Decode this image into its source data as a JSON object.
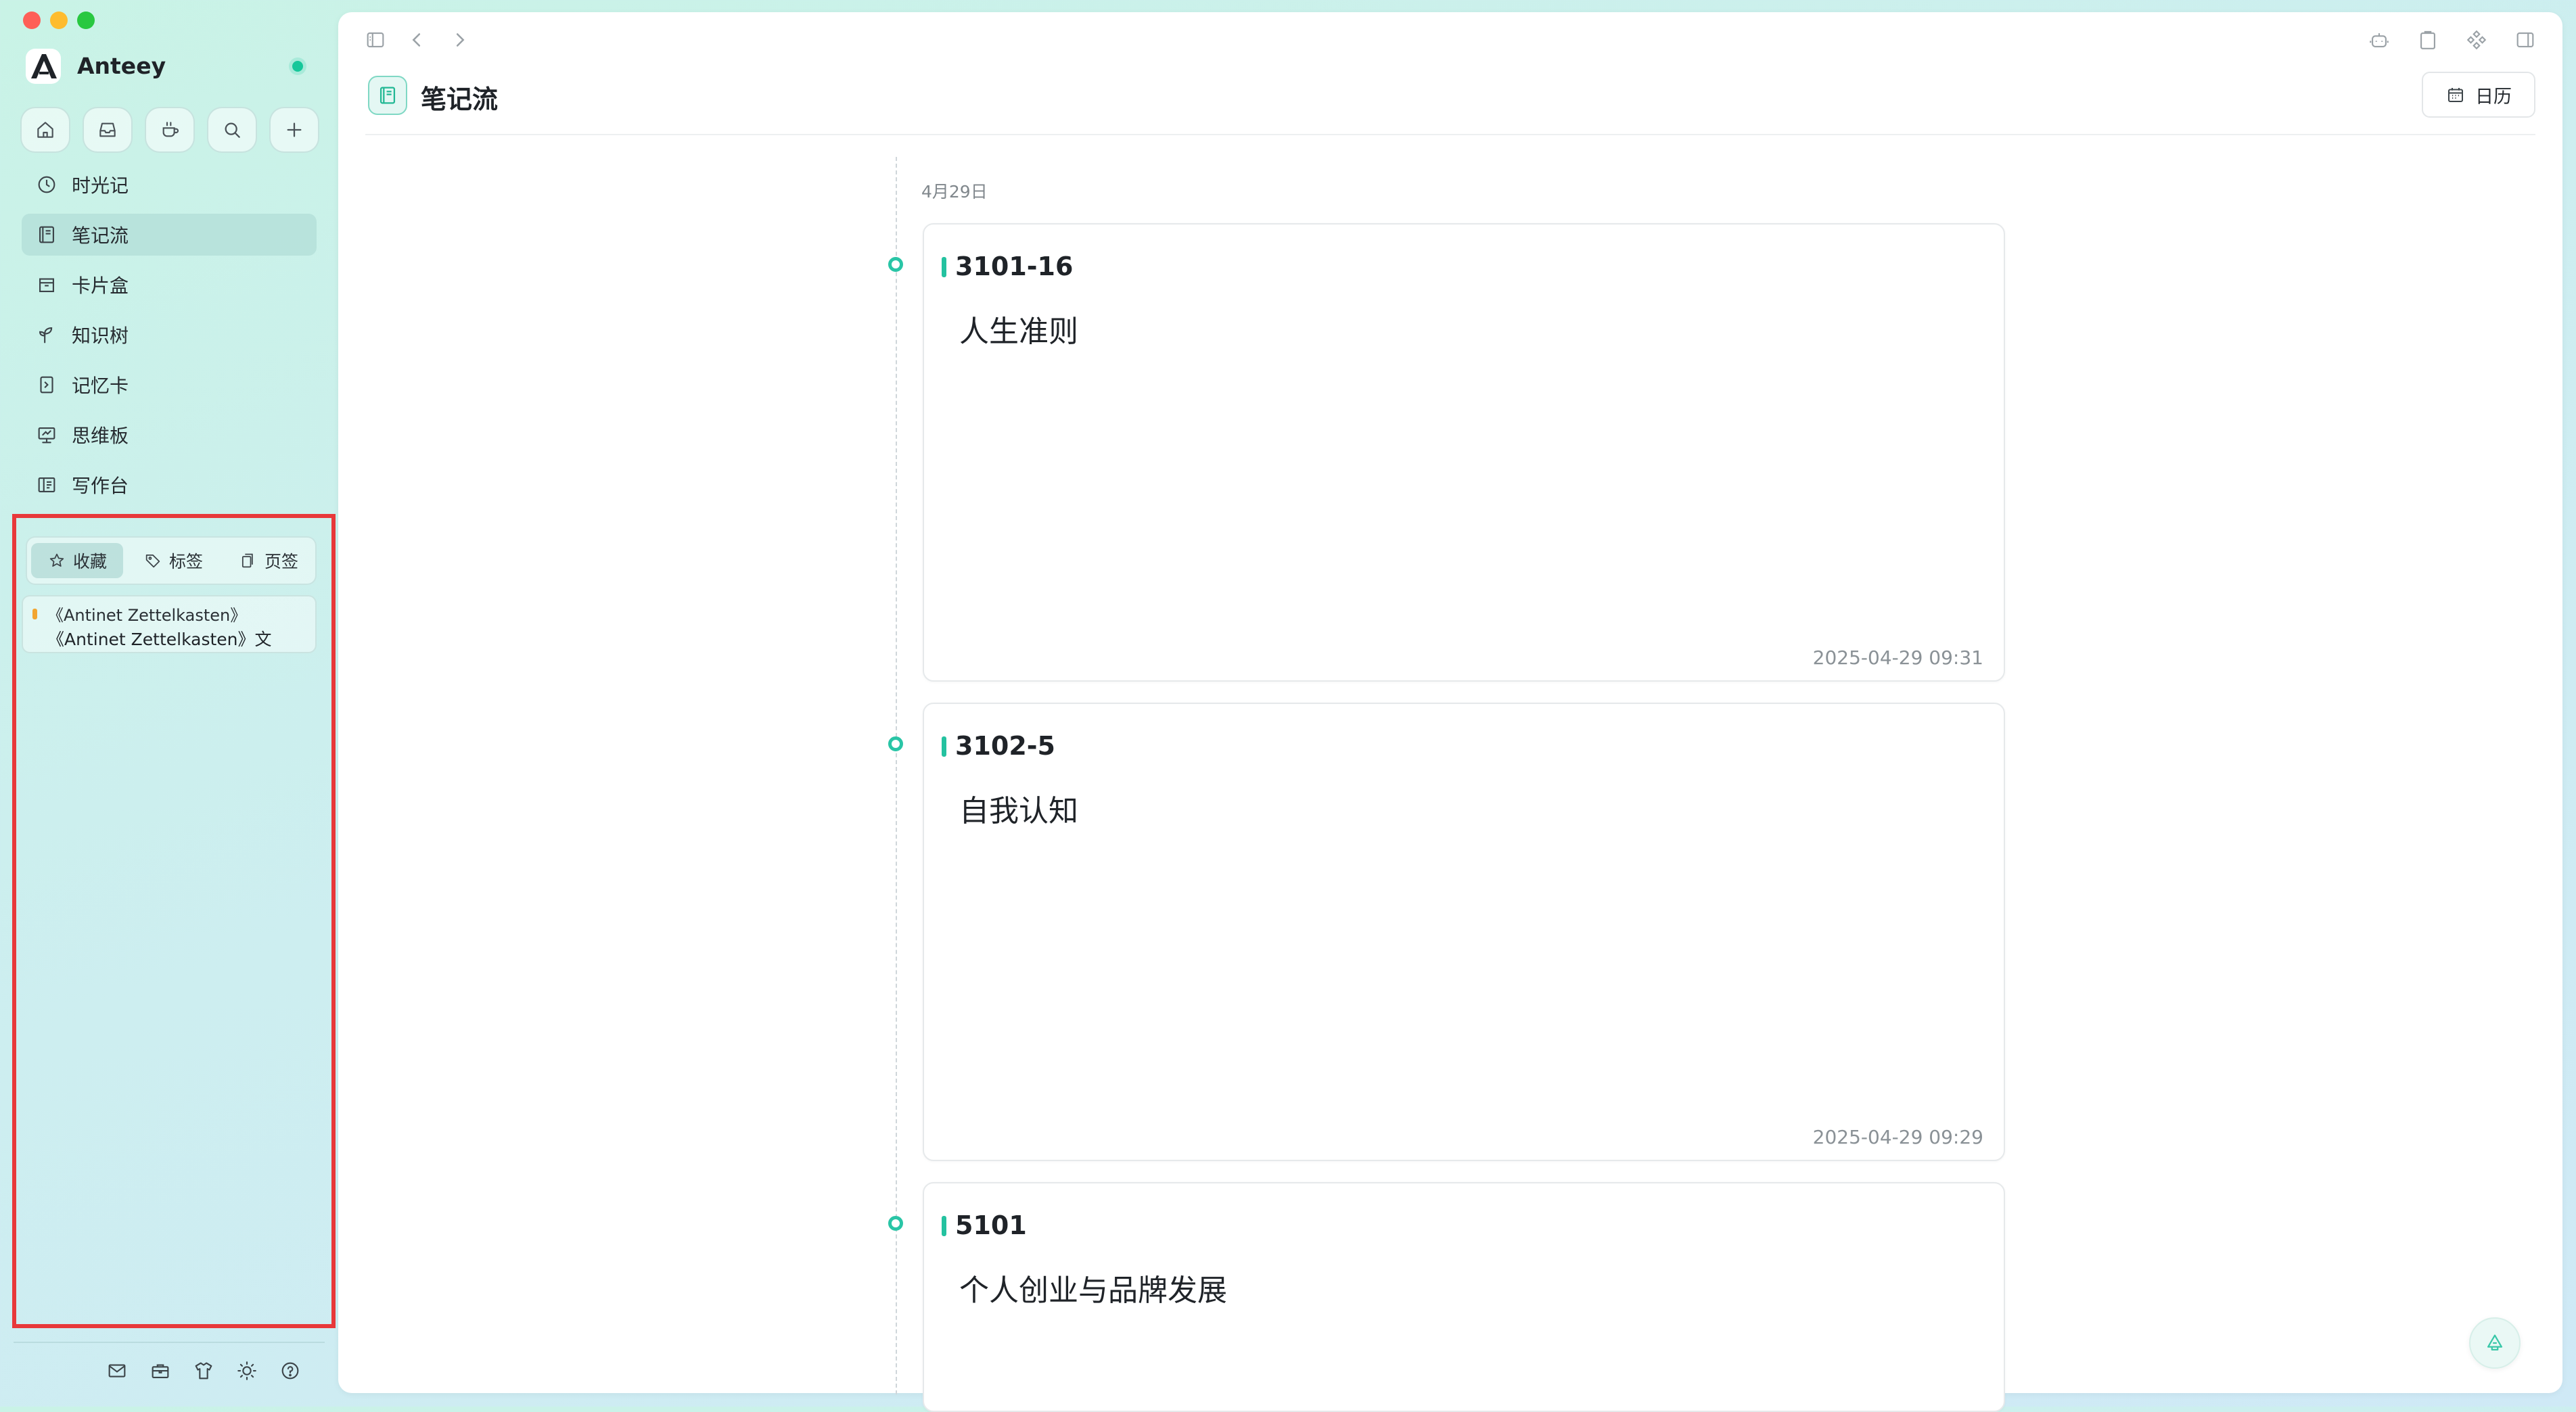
{
  "window": {
    "traffic_lights": [
      {
        "name": "close",
        "color": "#fe5f57"
      },
      {
        "name": "minimize",
        "color": "#febc2e"
      },
      {
        "name": "zoom",
        "color": "#28c840"
      }
    ]
  },
  "sidebar": {
    "app_name": "Anteey",
    "status_color": "#16c79a",
    "quick_actions": [
      "home-icon",
      "inbox-icon",
      "coffee-cup-icon",
      "search-icon",
      "plus-icon"
    ],
    "nav": [
      {
        "label": "时光记",
        "icon": "clock-icon",
        "active": false
      },
      {
        "label": "笔记流",
        "icon": "notebook-icon",
        "active": true
      },
      {
        "label": "卡片盒",
        "icon": "card-box-icon",
        "active": false
      },
      {
        "label": "知识树",
        "icon": "sprout-icon",
        "active": false
      },
      {
        "label": "记忆卡",
        "icon": "memory-card-icon",
        "active": false
      },
      {
        "label": "思维板",
        "icon": "whiteboard-icon",
        "active": false
      },
      {
        "label": "写作台",
        "icon": "writing-desk-icon",
        "active": false
      }
    ],
    "tabs": [
      {
        "label": "收藏",
        "icon": "star-icon",
        "active": true
      },
      {
        "label": "标签",
        "icon": "tag-icon",
        "active": false
      },
      {
        "label": "页签",
        "icon": "bookmark-pages-icon",
        "active": false
      }
    ],
    "favorites": [
      {
        "line1": "《Antinet Zettelkasten》",
        "line2": "《Antinet Zettelkasten》文",
        "color": "#f2a530"
      }
    ],
    "bottom_icons": [
      "mail-icon",
      "toolbox-icon",
      "shirt-icon",
      "sun-icon",
      "help-icon"
    ]
  },
  "toolbar": {
    "left_icons": [
      "sidebar-toggle-icon",
      "back-arrow-icon",
      "forward-arrow-icon"
    ],
    "right_icons": [
      "robot-icon",
      "clipboard-icon",
      "shuffle-icon",
      "right-panel-icon"
    ]
  },
  "page": {
    "title": "笔记流",
    "calendar_label": "日历"
  },
  "feed": {
    "date": "4月29日",
    "accent": "#24c2a0",
    "notes": [
      {
        "id": "3101-16",
        "content": "人生准则",
        "time": "2025-04-29 09:31"
      },
      {
        "id": "3102-5",
        "content": "自我认知",
        "time": "2025-04-29 09:29"
      },
      {
        "id": "5101",
        "content": "个人创业与品牌发展",
        "time": ""
      }
    ]
  }
}
